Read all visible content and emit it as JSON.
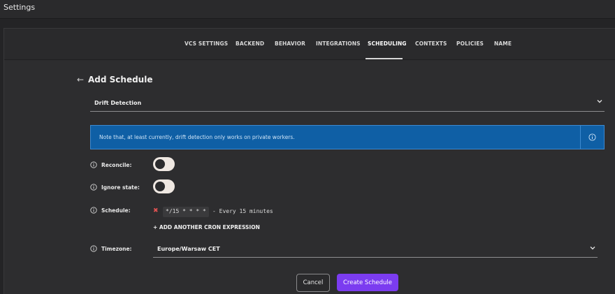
{
  "window": {
    "title": "Settings"
  },
  "tabs": [
    {
      "label": "VCS SETTINGS"
    },
    {
      "label": "BACKEND"
    },
    {
      "label": "BEHAVIOR"
    },
    {
      "label": "INTEGRATIONS"
    },
    {
      "label": "SCHEDULING",
      "active": true
    },
    {
      "label": "CONTEXTS"
    },
    {
      "label": "POLICIES"
    },
    {
      "label": "NAME"
    }
  ],
  "form": {
    "heading": "Add Schedule",
    "schedule_type": {
      "value": "Drift Detection",
      "icon": "chevron-down-icon"
    },
    "note": {
      "text": "Note that, at least currently, drift detection only works on private workers.",
      "icon": "info-icon"
    },
    "reconcile": {
      "label": "Reconcile:",
      "on": false
    },
    "ignore_state": {
      "label": "Ignore state:",
      "on": false
    },
    "schedule": {
      "label": "Schedule:",
      "cron": "*/15 * * * *",
      "description": "- Every 15 minutes",
      "remove_icon": "close-icon",
      "add_label": "+ ADD ANOTHER CRON EXPRESSION"
    },
    "timezone": {
      "label": "Timezone:",
      "value": "Europe/Warsaw CET",
      "icon": "chevron-down-icon"
    },
    "buttons": {
      "cancel": "Cancel",
      "create": "Create Schedule"
    }
  },
  "colors": {
    "background": "#242426",
    "panel": "#2d2d2f",
    "note_bg": "#0f5fa5",
    "accent": "#7b3cf0",
    "error": "#e05252"
  }
}
